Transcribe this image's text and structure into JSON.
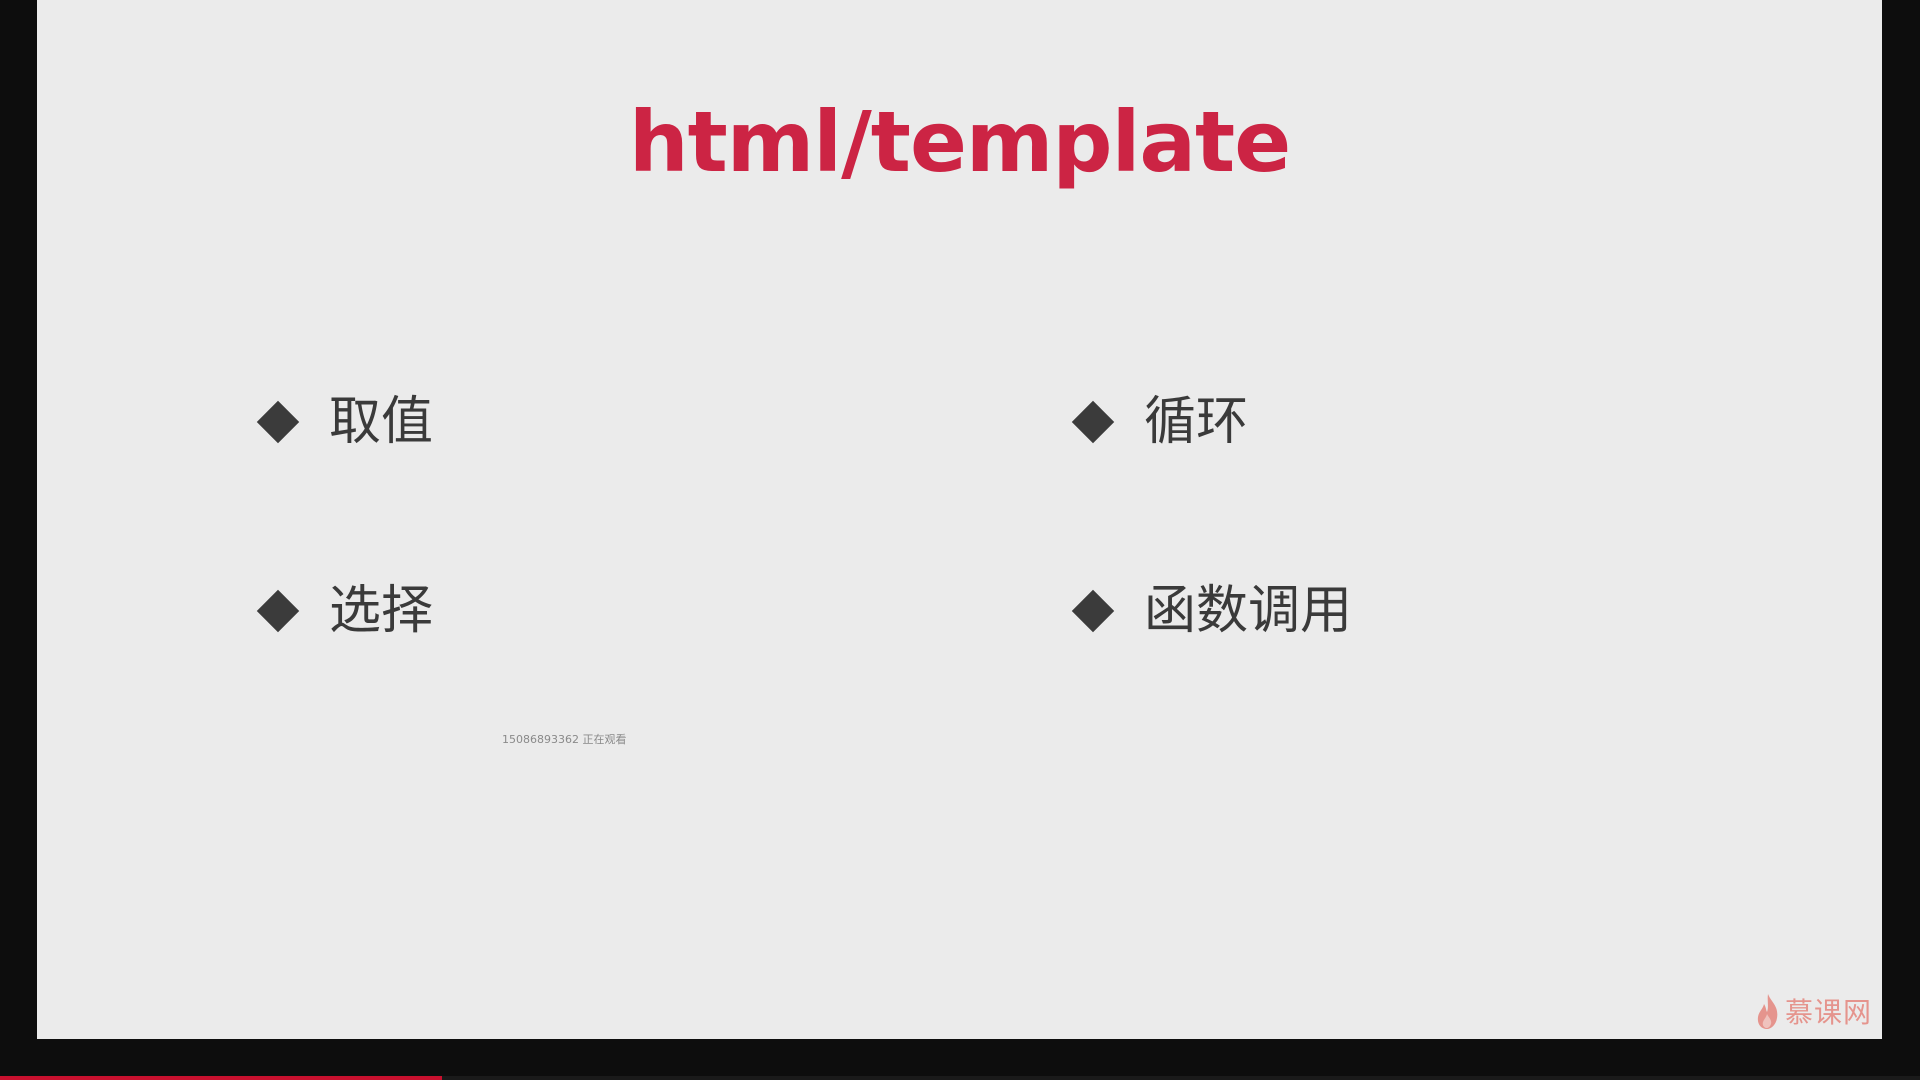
{
  "slide": {
    "title": "html/template",
    "bullets": [
      {
        "label": "取值"
      },
      {
        "label": "循环"
      },
      {
        "label": "选择"
      },
      {
        "label": "函数调用"
      }
    ],
    "watcher_text": "15086893362 正在观看"
  },
  "brand": {
    "name": "慕课网",
    "icon": "flame-icon"
  },
  "player": {
    "progress_fraction": 0.23
  },
  "colors": {
    "title": "#cc2444",
    "bullet": "#3b3b3b",
    "slide_background": "#ebebeb",
    "frame": "#0d0d0d",
    "progress": "#c8102e"
  }
}
